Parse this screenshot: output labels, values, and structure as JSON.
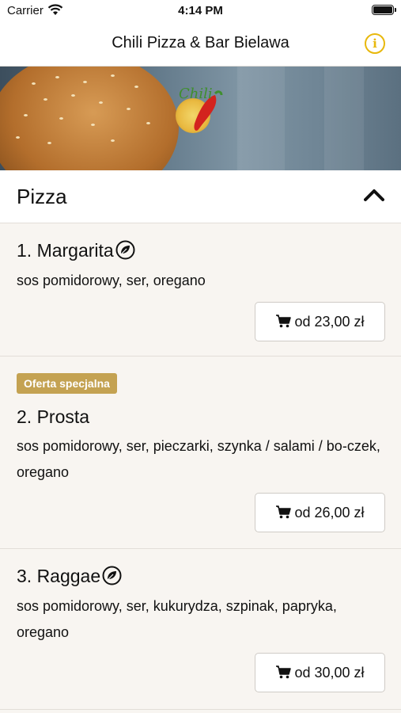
{
  "status": {
    "carrier": "Carrier",
    "time": "4:14 PM"
  },
  "nav": {
    "title": "Chili Pizza & Bar Bielawa",
    "info_icon": "info-icon"
  },
  "banner": {
    "logo_text": "Chili"
  },
  "section": {
    "title": "Pizza",
    "expanded": true
  },
  "items": [
    {
      "title": "1. Margarita",
      "vegetarian": true,
      "badge": "",
      "desc": " sos pomidorowy, ser, oregano",
      "price": "od 23,00 zł"
    },
    {
      "title": "2. Prosta",
      "vegetarian": false,
      "badge": "Oferta specjalna",
      "desc": "sos pomidorowy, ser, pieczarki, szynka / salami / bo-czek, oregano",
      "price": "od 26,00 zł"
    },
    {
      "title": "3. Raggae",
      "vegetarian": true,
      "badge": "",
      "desc": " sos pomidorowy, ser, kukurydza, szpinak, papryka, oregano",
      "price": "od 30,00 zł"
    }
  ],
  "colors": {
    "accent": "#e8b80c",
    "badge": "#c4a252",
    "background": "#f8f5f1"
  }
}
